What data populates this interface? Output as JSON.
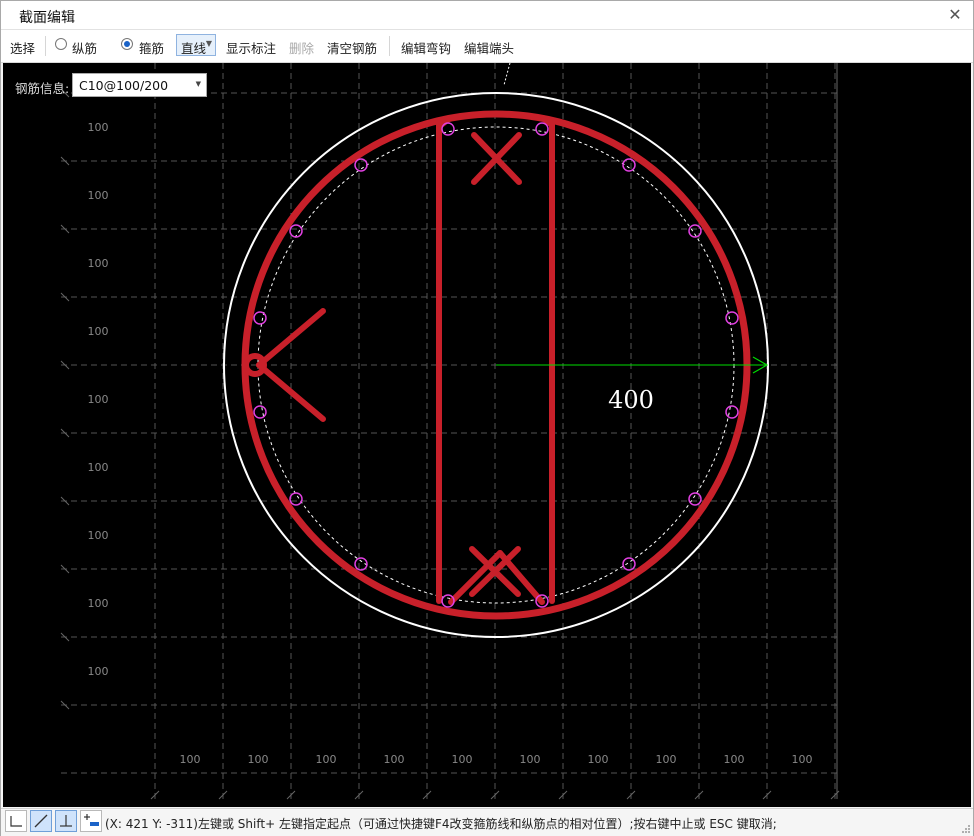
{
  "window": {
    "title": "截面编辑"
  },
  "toolbar": {
    "select_label": "选择",
    "longitudinal_label": "纵筋",
    "stirrup_label": "箍筋",
    "mode_value": "直线",
    "show_annotation_label": "显示标注",
    "delete_label": "删除",
    "clear_rebar_label": "清空钢筋",
    "edit_hook_label": "编辑弯钩",
    "edit_end_label": "编辑端头"
  },
  "rebar_info": {
    "label": "钢筋信息:",
    "value": "C10@100/200"
  },
  "drawing": {
    "radius_dimension": "400",
    "grid_tick_label": "100",
    "stirrup_color": "#c8202a",
    "rebar_point_color": "#e040e0",
    "dimension_color": "#00dd00",
    "outline_color": "#ffffff"
  },
  "status": {
    "text": "(X: 421 Y: -311)左键或 Shift+ 左键指定起点（可通过快捷键F4改变箍筋线和纵筋点的相对位置）;按右键中止或 ESC 键取消;"
  }
}
